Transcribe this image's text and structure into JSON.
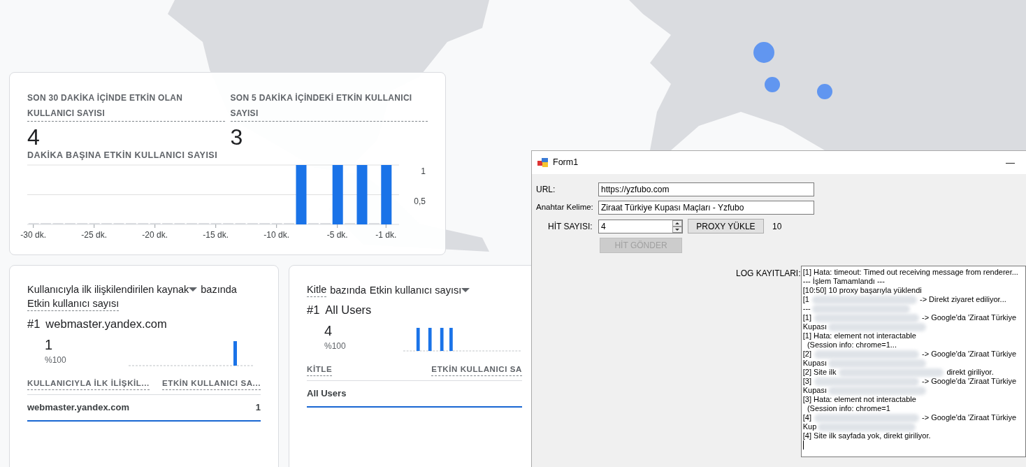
{
  "realtime_card": {
    "metrics": [
      {
        "label": "SON 30 DAKİKA İÇİNDE ETKİN OLAN KULLANICI SAYISI",
        "value": "4"
      },
      {
        "label": "SON 5 DAKİKA İÇİNDEKİ ETKİN KULLANICI SAYISI",
        "value": "3"
      }
    ],
    "chart_title": "DAKİKA BAŞINA ETKİN KULLANICI SAYISI",
    "chart_data": {
      "type": "bar",
      "x": [
        -30,
        -29,
        -28,
        -27,
        -26,
        -25,
        -24,
        -23,
        -22,
        -21,
        -20,
        -19,
        -18,
        -17,
        -16,
        -15,
        -14,
        -13,
        -12,
        -11,
        -10,
        -9,
        -8,
        -7,
        -6,
        -5,
        -4,
        -3,
        -2,
        -1
      ],
      "values": [
        0,
        0,
        0,
        0,
        0,
        0,
        0,
        0,
        0,
        0,
        0,
        0,
        0,
        0,
        0,
        0,
        0,
        0,
        0,
        0,
        0,
        0,
        1,
        0,
        0,
        1,
        0,
        1,
        0,
        1
      ],
      "xlim": [
        -30.5,
        -0.5
      ],
      "ylim": [
        0,
        1
      ],
      "xticks": [
        {
          "value": -30,
          "label": "-30 dk."
        },
        {
          "value": -25,
          "label": "-25 dk."
        },
        {
          "value": -20,
          "label": "-20 dk."
        },
        {
          "value": -15,
          "label": "-15 dk."
        },
        {
          "value": -10,
          "label": "-10 dk."
        },
        {
          "value": -5,
          "label": "-5 dk."
        },
        {
          "value": -1,
          "label": "-1 dk."
        }
      ],
      "yticks": [
        {
          "value": 0.5,
          "label": "0,5"
        },
        {
          "value": 1,
          "label": "1"
        }
      ]
    }
  },
  "breakdown_cards": [
    {
      "title_parts": [
        {
          "text": "Kullanıcıyla ilk ilişkilendirilen kaynak",
          "underline": false,
          "dropdown": true
        },
        {
          "text": "bazında",
          "underline": false,
          "dropdown": false
        },
        {
          "text": "Etkin kullanıcı sayısı",
          "underline": true,
          "dropdown": false
        }
      ],
      "rank": "#1",
      "top_name": "webmaster.yandex.com",
      "value": "1",
      "share": "%100",
      "columns": [
        "KULLANICIYLA İLK İLİŞKİL...",
        "ETKİN KULLANICI SA..."
      ],
      "rows": [
        {
          "cells": [
            "webmaster.yandex.com",
            "1"
          ]
        }
      ]
    },
    {
      "title_parts": [
        {
          "text": "Kitle",
          "underline": true,
          "dropdown": false
        },
        {
          "text": "bazında",
          "underline": false,
          "dropdown": false
        },
        {
          "text": "Etkin kullanıcı sayısı",
          "underline": false,
          "dropdown": true
        }
      ],
      "rank": "#1",
      "top_name": "All Users",
      "value": "4",
      "share": "%100",
      "columns": [
        "KİTLE",
        "ETKİN KULLANICI SA"
      ],
      "rows": [
        {
          "cells": [
            "All Users"
          ]
        }
      ]
    }
  ],
  "form_window": {
    "title": "Form1",
    "minimize": "—",
    "url_label": "URL:",
    "url_value": "https://yzfubo.com",
    "keyword_label": "Anahtar Kelime:",
    "keyword_value": "Ziraat Türkiye Kupası Maçları - Yzfubo",
    "hit_label": "HİT SAYISI:",
    "hit_value": "4",
    "proxy_button": "PROXY YÜKLE",
    "proxy_count": "10",
    "send_button": {
      "label": "HİT GÖNDER",
      "disabled": true
    },
    "log_label": "LOG KAYITLARI:",
    "log_lines": [
      {
        "kind": "text",
        "text": "[1] Hata: timeout: Timed out receiving message from renderer..."
      },
      {
        "kind": "text",
        "text": "--- İşlem Tamamlandı ---"
      },
      {
        "kind": "text",
        "text": "[10:50] 10 proxy başarıyla yüklendi"
      },
      {
        "kind": "redacted",
        "prefix": "[1",
        "suffix": "-> Direkt ziyaret ediliyor..."
      },
      {
        "kind": "redacted",
        "prefix": "---"
      },
      {
        "kind": "redacted",
        "prefix": "[1]",
        "suffix": "-> Google'da 'Ziraat Türkiye"
      },
      {
        "kind": "redacted",
        "prefix": "Kupası"
      },
      {
        "kind": "text",
        "text": "[1] Hata: element not interactable"
      },
      {
        "kind": "text",
        "text": "  (Session info: chrome=1..."
      },
      {
        "kind": "redacted",
        "prefix": "[2]",
        "suffix": "-> Google'da 'Ziraat Türkiye"
      },
      {
        "kind": "redacted",
        "prefix": "Kupası"
      },
      {
        "kind": "redacted",
        "prefix": "[2] Site ilk",
        "suffix": "direkt giriliyor."
      },
      {
        "kind": "redacted",
        "prefix": "[3]",
        "suffix": "-> Google'da 'Ziraat Türkiye"
      },
      {
        "kind": "redacted",
        "prefix": "Kupası"
      },
      {
        "kind": "text",
        "text": "[3] Hata: element not interactable"
      },
      {
        "kind": "text",
        "text": "  (Session info: chrome=1"
      },
      {
        "kind": "redacted",
        "prefix": "[4]",
        "suffix": "-> Google'da 'Ziraat Türkiye"
      },
      {
        "kind": "redacted",
        "prefix": "Kup"
      },
      {
        "kind": "text",
        "text": "[4] Site ilk sayfada yok, direkt giriliyor."
      }
    ]
  }
}
